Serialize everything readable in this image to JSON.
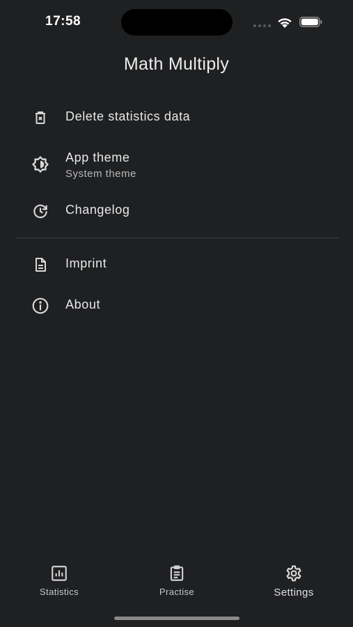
{
  "status_bar": {
    "time": "17:58"
  },
  "app": {
    "title": "Math Multiply"
  },
  "menu": {
    "items": [
      {
        "label": "Delete statistics data",
        "icon": "trash-icon"
      },
      {
        "label": "App theme",
        "sub": "System theme",
        "icon": "theme-icon"
      },
      {
        "label": "Changelog",
        "icon": "history-icon"
      },
      {
        "label": "Imprint",
        "icon": "document-icon"
      },
      {
        "label": "About",
        "icon": "info-icon"
      }
    ]
  },
  "bottom_nav": {
    "items": [
      {
        "label": "Statistics",
        "icon": "bar-chart-icon"
      },
      {
        "label": "Practise",
        "icon": "clipboard-icon"
      },
      {
        "label": "Settings",
        "icon": "gear-icon",
        "active": true
      }
    ]
  },
  "colors": {
    "background": "#1f2022",
    "text": "#e8e8e8",
    "divider": "#3a3b3d"
  }
}
